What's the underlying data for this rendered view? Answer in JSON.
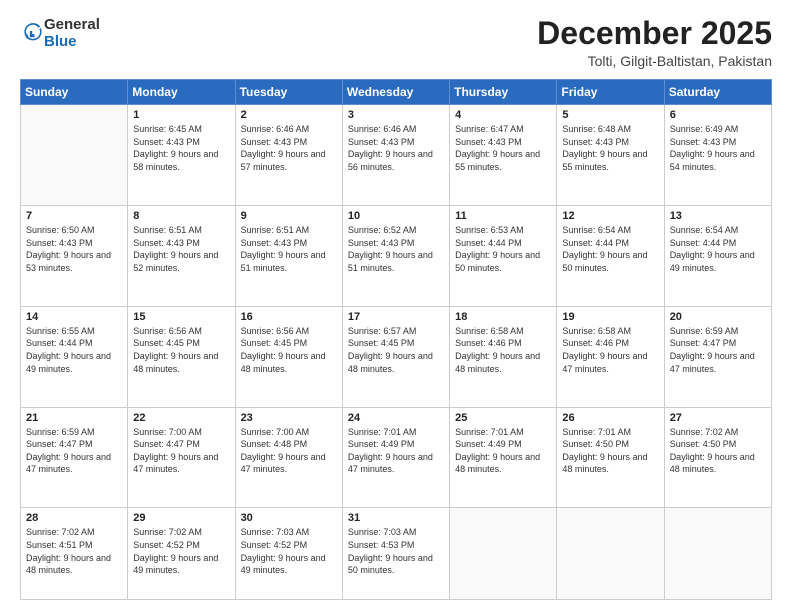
{
  "header": {
    "logo_general": "General",
    "logo_blue": "Blue",
    "title": "December 2025",
    "subtitle": "Tolti, Gilgit-Baltistan, Pakistan"
  },
  "calendar": {
    "days_of_week": [
      "Sunday",
      "Monday",
      "Tuesday",
      "Wednesday",
      "Thursday",
      "Friday",
      "Saturday"
    ],
    "weeks": [
      [
        {
          "day": "",
          "sunrise": "",
          "sunset": "",
          "daylight": ""
        },
        {
          "day": "1",
          "sunrise": "Sunrise: 6:45 AM",
          "sunset": "Sunset: 4:43 PM",
          "daylight": "Daylight: 9 hours and 58 minutes."
        },
        {
          "day": "2",
          "sunrise": "Sunrise: 6:46 AM",
          "sunset": "Sunset: 4:43 PM",
          "daylight": "Daylight: 9 hours and 57 minutes."
        },
        {
          "day": "3",
          "sunrise": "Sunrise: 6:46 AM",
          "sunset": "Sunset: 4:43 PM",
          "daylight": "Daylight: 9 hours and 56 minutes."
        },
        {
          "day": "4",
          "sunrise": "Sunrise: 6:47 AM",
          "sunset": "Sunset: 4:43 PM",
          "daylight": "Daylight: 9 hours and 55 minutes."
        },
        {
          "day": "5",
          "sunrise": "Sunrise: 6:48 AM",
          "sunset": "Sunset: 4:43 PM",
          "daylight": "Daylight: 9 hours and 55 minutes."
        },
        {
          "day": "6",
          "sunrise": "Sunrise: 6:49 AM",
          "sunset": "Sunset: 4:43 PM",
          "daylight": "Daylight: 9 hours and 54 minutes."
        }
      ],
      [
        {
          "day": "7",
          "sunrise": "Sunrise: 6:50 AM",
          "sunset": "Sunset: 4:43 PM",
          "daylight": "Daylight: 9 hours and 53 minutes."
        },
        {
          "day": "8",
          "sunrise": "Sunrise: 6:51 AM",
          "sunset": "Sunset: 4:43 PM",
          "daylight": "Daylight: 9 hours and 52 minutes."
        },
        {
          "day": "9",
          "sunrise": "Sunrise: 6:51 AM",
          "sunset": "Sunset: 4:43 PM",
          "daylight": "Daylight: 9 hours and 51 minutes."
        },
        {
          "day": "10",
          "sunrise": "Sunrise: 6:52 AM",
          "sunset": "Sunset: 4:43 PM",
          "daylight": "Daylight: 9 hours and 51 minutes."
        },
        {
          "day": "11",
          "sunrise": "Sunrise: 6:53 AM",
          "sunset": "Sunset: 4:44 PM",
          "daylight": "Daylight: 9 hours and 50 minutes."
        },
        {
          "day": "12",
          "sunrise": "Sunrise: 6:54 AM",
          "sunset": "Sunset: 4:44 PM",
          "daylight": "Daylight: 9 hours and 50 minutes."
        },
        {
          "day": "13",
          "sunrise": "Sunrise: 6:54 AM",
          "sunset": "Sunset: 4:44 PM",
          "daylight": "Daylight: 9 hours and 49 minutes."
        }
      ],
      [
        {
          "day": "14",
          "sunrise": "Sunrise: 6:55 AM",
          "sunset": "Sunset: 4:44 PM",
          "daylight": "Daylight: 9 hours and 49 minutes."
        },
        {
          "day": "15",
          "sunrise": "Sunrise: 6:56 AM",
          "sunset": "Sunset: 4:45 PM",
          "daylight": "Daylight: 9 hours and 48 minutes."
        },
        {
          "day": "16",
          "sunrise": "Sunrise: 6:56 AM",
          "sunset": "Sunset: 4:45 PM",
          "daylight": "Daylight: 9 hours and 48 minutes."
        },
        {
          "day": "17",
          "sunrise": "Sunrise: 6:57 AM",
          "sunset": "Sunset: 4:45 PM",
          "daylight": "Daylight: 9 hours and 48 minutes."
        },
        {
          "day": "18",
          "sunrise": "Sunrise: 6:58 AM",
          "sunset": "Sunset: 4:46 PM",
          "daylight": "Daylight: 9 hours and 48 minutes."
        },
        {
          "day": "19",
          "sunrise": "Sunrise: 6:58 AM",
          "sunset": "Sunset: 4:46 PM",
          "daylight": "Daylight: 9 hours and 47 minutes."
        },
        {
          "day": "20",
          "sunrise": "Sunrise: 6:59 AM",
          "sunset": "Sunset: 4:47 PM",
          "daylight": "Daylight: 9 hours and 47 minutes."
        }
      ],
      [
        {
          "day": "21",
          "sunrise": "Sunrise: 6:59 AM",
          "sunset": "Sunset: 4:47 PM",
          "daylight": "Daylight: 9 hours and 47 minutes."
        },
        {
          "day": "22",
          "sunrise": "Sunrise: 7:00 AM",
          "sunset": "Sunset: 4:47 PM",
          "daylight": "Daylight: 9 hours and 47 minutes."
        },
        {
          "day": "23",
          "sunrise": "Sunrise: 7:00 AM",
          "sunset": "Sunset: 4:48 PM",
          "daylight": "Daylight: 9 hours and 47 minutes."
        },
        {
          "day": "24",
          "sunrise": "Sunrise: 7:01 AM",
          "sunset": "Sunset: 4:49 PM",
          "daylight": "Daylight: 9 hours and 47 minutes."
        },
        {
          "day": "25",
          "sunrise": "Sunrise: 7:01 AM",
          "sunset": "Sunset: 4:49 PM",
          "daylight": "Daylight: 9 hours and 48 minutes."
        },
        {
          "day": "26",
          "sunrise": "Sunrise: 7:01 AM",
          "sunset": "Sunset: 4:50 PM",
          "daylight": "Daylight: 9 hours and 48 minutes."
        },
        {
          "day": "27",
          "sunrise": "Sunrise: 7:02 AM",
          "sunset": "Sunset: 4:50 PM",
          "daylight": "Daylight: 9 hours and 48 minutes."
        }
      ],
      [
        {
          "day": "28",
          "sunrise": "Sunrise: 7:02 AM",
          "sunset": "Sunset: 4:51 PM",
          "daylight": "Daylight: 9 hours and 48 minutes."
        },
        {
          "day": "29",
          "sunrise": "Sunrise: 7:02 AM",
          "sunset": "Sunset: 4:52 PM",
          "daylight": "Daylight: 9 hours and 49 minutes."
        },
        {
          "day": "30",
          "sunrise": "Sunrise: 7:03 AM",
          "sunset": "Sunset: 4:52 PM",
          "daylight": "Daylight: 9 hours and 49 minutes."
        },
        {
          "day": "31",
          "sunrise": "Sunrise: 7:03 AM",
          "sunset": "Sunset: 4:53 PM",
          "daylight": "Daylight: 9 hours and 50 minutes."
        },
        {
          "day": "",
          "sunrise": "",
          "sunset": "",
          "daylight": ""
        },
        {
          "day": "",
          "sunrise": "",
          "sunset": "",
          "daylight": ""
        },
        {
          "day": "",
          "sunrise": "",
          "sunset": "",
          "daylight": ""
        }
      ]
    ]
  }
}
